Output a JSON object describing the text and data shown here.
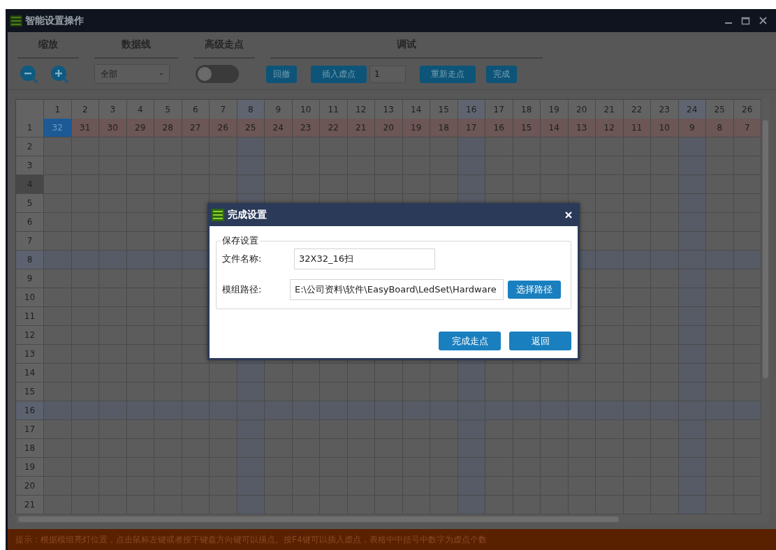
{
  "window": {
    "title": "智能设置操作"
  },
  "toolbar": {
    "groups": [
      {
        "title": "缩放"
      },
      {
        "title": "数据线"
      },
      {
        "title": "高级走点"
      },
      {
        "title": "调试"
      }
    ],
    "dropdown": {
      "value": "全部"
    },
    "toggle": {
      "on": false
    },
    "undo_button": "回撤",
    "insert_button": "插入虚点",
    "count_field": {
      "value": "1"
    },
    "rewalk_button": "重新走点",
    "finish_button": "完成"
  },
  "grid": {
    "columns": [
      {
        "label": "1",
        "highlighted": false
      },
      {
        "label": "2",
        "highlighted": false
      },
      {
        "label": "3",
        "highlighted": false
      },
      {
        "label": "4",
        "highlighted": false
      },
      {
        "label": "5",
        "highlighted": false
      },
      {
        "label": "6",
        "highlighted": false
      },
      {
        "label": "7",
        "highlighted": false
      },
      {
        "label": "8",
        "highlighted": true
      },
      {
        "label": "9",
        "highlighted": false
      },
      {
        "label": "10",
        "highlighted": false
      },
      {
        "label": "11",
        "highlighted": false
      },
      {
        "label": "12",
        "highlighted": false
      },
      {
        "label": "13",
        "highlighted": false
      },
      {
        "label": "14",
        "highlighted": false
      },
      {
        "label": "15",
        "highlighted": false
      },
      {
        "label": "16",
        "highlighted": true
      },
      {
        "label": "17",
        "highlighted": false
      },
      {
        "label": "18",
        "highlighted": false
      },
      {
        "label": "19",
        "highlighted": false
      },
      {
        "label": "20",
        "highlighted": false
      },
      {
        "label": "21",
        "highlighted": false
      },
      {
        "label": "22",
        "highlighted": false
      },
      {
        "label": "23",
        "highlighted": false
      },
      {
        "label": "24",
        "highlighted": true
      },
      {
        "label": "25",
        "highlighted": false
      },
      {
        "label": "26",
        "highlighted": false
      }
    ],
    "rows": [
      {
        "label": "1",
        "selected": false,
        "highlighted": false,
        "cells": [
          {
            "text": "32",
            "selected": true
          },
          {
            "text": "31",
            "selected": false
          },
          {
            "text": "30",
            "selected": false
          },
          {
            "text": "29",
            "selected": false
          },
          {
            "text": "28",
            "selected": false
          },
          {
            "text": "27",
            "selected": false
          },
          {
            "text": "26",
            "selected": false
          },
          {
            "text": "25",
            "selected": false
          },
          {
            "text": "24",
            "selected": false
          },
          {
            "text": "23",
            "selected": false
          },
          {
            "text": "22",
            "selected": false
          },
          {
            "text": "21",
            "selected": false
          },
          {
            "text": "20",
            "selected": false
          },
          {
            "text": "19",
            "selected": false
          },
          {
            "text": "18",
            "selected": false
          },
          {
            "text": "17",
            "selected": false
          },
          {
            "text": "16",
            "selected": false
          },
          {
            "text": "15",
            "selected": false
          },
          {
            "text": "14",
            "selected": false
          },
          {
            "text": "13",
            "selected": false
          },
          {
            "text": "12",
            "selected": false
          },
          {
            "text": "11",
            "selected": false
          },
          {
            "text": "10",
            "selected": false
          },
          {
            "text": "9",
            "selected": false
          },
          {
            "text": "8",
            "selected": false
          },
          {
            "text": "7",
            "selected": false
          }
        ]
      },
      {
        "label": "2",
        "selected": false,
        "highlighted": false
      },
      {
        "label": "3",
        "selected": false,
        "highlighted": false
      },
      {
        "label": "4",
        "selected": true,
        "highlighted": false
      },
      {
        "label": "5",
        "selected": false,
        "highlighted": false
      },
      {
        "label": "6",
        "selected": false,
        "highlighted": false
      },
      {
        "label": "7",
        "selected": false,
        "highlighted": false
      },
      {
        "label": "8",
        "selected": false,
        "highlighted": true
      },
      {
        "label": "9",
        "selected": false,
        "highlighted": false
      },
      {
        "label": "10",
        "selected": false,
        "highlighted": false
      },
      {
        "label": "11",
        "selected": false,
        "highlighted": false
      },
      {
        "label": "12",
        "selected": false,
        "highlighted": false
      },
      {
        "label": "13",
        "selected": false,
        "highlighted": false
      },
      {
        "label": "14",
        "selected": false,
        "highlighted": false
      },
      {
        "label": "15",
        "selected": false,
        "highlighted": false
      },
      {
        "label": "16",
        "selected": false,
        "highlighted": true
      },
      {
        "label": "17",
        "selected": false,
        "highlighted": false
      },
      {
        "label": "18",
        "selected": false,
        "highlighted": false
      },
      {
        "label": "19",
        "selected": false,
        "highlighted": false
      },
      {
        "label": "20",
        "selected": false,
        "highlighted": false
      },
      {
        "label": "21",
        "selected": false,
        "highlighted": false
      }
    ]
  },
  "dialog": {
    "title": "完成设置",
    "group_title": "保存设置",
    "fields": [
      {
        "label": "文件名称:",
        "value": "32X32_16扫"
      },
      {
        "label": "模组路径:",
        "value": "E:\\公司资料\\软件\\EasyBoard\\LedSet\\Hardware"
      }
    ],
    "browse_button": "选择路径",
    "buttons": [
      "完成走点",
      "返回"
    ]
  },
  "status_bar": {
    "text": "提示：根据模组亮灯位置，点击鼠标左键或者按下键盘方向键可以描点。按F4键可以插入虚点，表格中中括号中数字为虚点个数"
  }
}
